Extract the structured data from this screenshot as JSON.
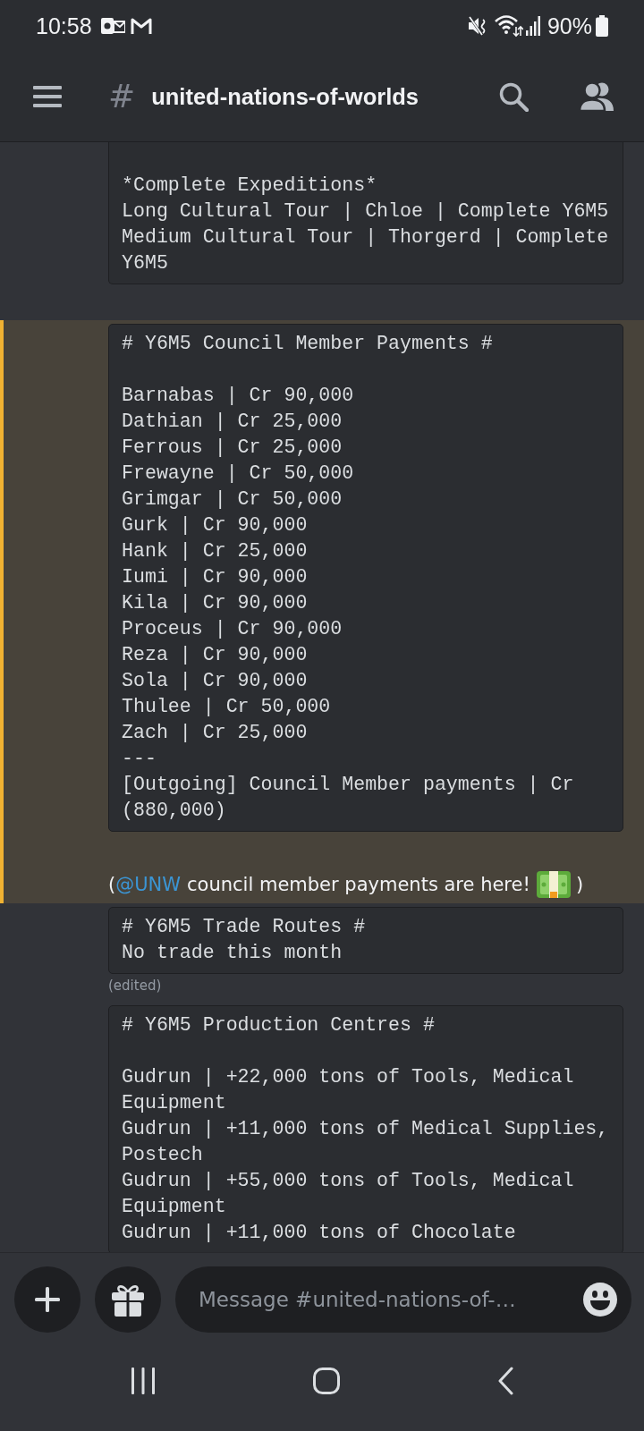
{
  "status_bar": {
    "time": "10:58",
    "battery": "90%"
  },
  "header": {
    "hash": "#",
    "channel": "united-nations-of-worlds"
  },
  "messages": [
    {
      "mentioned": false,
      "parts": [
        {
          "kind": "code",
          "sections": [
            [
              "*Complete Expeditions*",
              "Long Cultural Tour | Chloe | Complete Y6M5",
              "Medium Cultural Tour | Thorgerd | Complete Y6M5"
            ]
          ]
        }
      ]
    },
    {
      "mentioned": true,
      "parts": [
        {
          "kind": "code",
          "sections": [
            [
              "# Y6M5 Council Member Payments #"
            ],
            [
              "Barnabas | Cr 90,000",
              "Dathian | Cr 25,000",
              "Ferrous | Cr 25,000",
              "Frewayne | Cr 50,000",
              "Grimgar | Cr 50,000",
              "Gurk | Cr 90,000",
              "Hank | Cr 25,000",
              "Iumi | Cr 90,000",
              "Kila | Cr 90,000",
              "Proceus | Cr 90,000",
              "Reza | Cr 90,000",
              "Sola | Cr 90,000",
              "Thulee | Cr 50,000",
              "Zach | Cr 25,000",
              "---",
              "[Outgoing] Council Member payments | Cr (880,000)"
            ]
          ]
        },
        {
          "kind": "text",
          "open": "(",
          "mention": "@UNW",
          "text": "council member payments are here!",
          "close": ")"
        }
      ]
    },
    {
      "mentioned": false,
      "parts": [
        {
          "kind": "code",
          "sections": [
            [
              "# Y6M5 Trade Routes #",
              "No trade this month"
            ]
          ]
        },
        {
          "kind": "edited",
          "label": "(edited)"
        }
      ]
    },
    {
      "mentioned": false,
      "parts": [
        {
          "kind": "code",
          "sections": [
            [
              "# Y6M5 Production Centres #"
            ],
            [
              "Gudrun | +22,000 tons of Tools, Medical Equipment",
              "Gudrun | +11,000 tons of Medical Supplies, Postech",
              "Gudrun | +55,000 tons of Tools, Medical Equipment",
              "Gudrun | +11,000 tons of Chocolate"
            ]
          ]
        }
      ]
    }
  ],
  "composer": {
    "placeholder": "Message #united-nations-of-…"
  }
}
